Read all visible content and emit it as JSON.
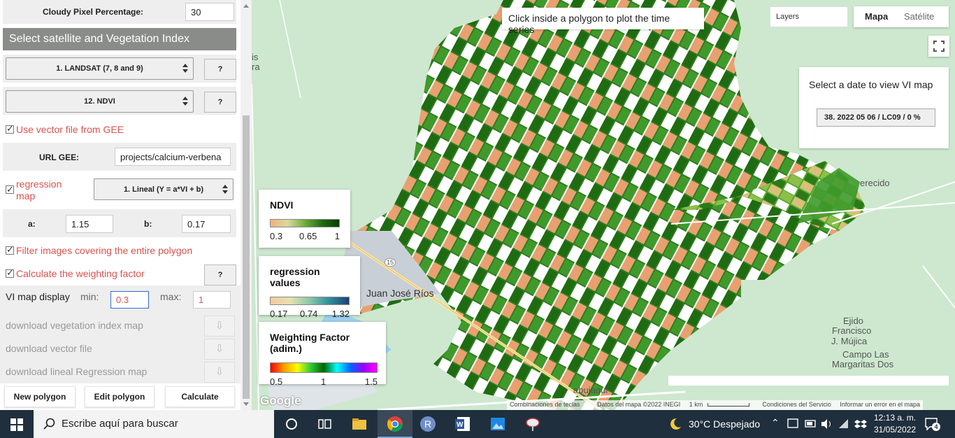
{
  "panel": {
    "cloudy_label": "Cloudy Pixel Percentage:",
    "cloudy_value": "30",
    "section_title": "Select satellite and Vegetation Index",
    "satellite_select": "1. LANDSAT (7, 8 and 9)",
    "index_select": "12. NDVI",
    "help_label": "?",
    "use_vector_label": "Use vector file from GEE",
    "url_label": "URL GEE:",
    "url_value": "projects/calcium-verbena",
    "regression_label": "regression map",
    "regression_select": "1. Lineal (Y = a*VI + b)",
    "a_label": "a:",
    "a_value": "1.15",
    "b_label": "b:",
    "b_value": "0.17",
    "filter_label": "Filter images covering the entire polygon",
    "weighting_label": "Calculate the weighting factor",
    "vi_display_label": "VI map display",
    "min_label": "min:",
    "min_value": "0.3",
    "max_label": "max:",
    "max_value": "1",
    "download_vi": "download vegetation index map",
    "download_vector": "download vector file",
    "download_regression": "download lineal Regression map",
    "download_icon": "⇩",
    "new_polygon": "New polygon",
    "edit_polygon": "Edit polygon",
    "calculate": "Calculate"
  },
  "map": {
    "notice": "Click inside a polygon to plot the time series",
    "layers": "Layers",
    "map_tab": "Mapa",
    "satellite_tab": "Satélite",
    "date_title": "Select a date to view VI map",
    "date_select": "38. 2022 05 06 / LC09 / 0 %",
    "places": {
      "juan_jose_rios": "Juan José Ríos",
      "ejido": "Ejido",
      "francisco": "Francisco",
      "mujica": "J. Mújica",
      "campo": "Campo Las",
      "margaritas": "Margaritas Dos",
      "merecido": "erecido",
      "abujaqui": "abujaqui",
      "route": "15",
      "left_is": "is",
      "left_ra": "ra"
    },
    "legends": {
      "ndvi": {
        "title": "NDVI",
        "min": "0.3",
        "mid": "0.65",
        "max": "1"
      },
      "regression": {
        "title": "regression values",
        "min": "0.17",
        "mid": "0.74",
        "max": "1.32"
      },
      "weighting": {
        "title": "Weighting Factor (adim.)",
        "min": "0.5",
        "mid": "1",
        "max": "1.5"
      }
    },
    "attribution": {
      "shortcuts": "Combinaciones de teclas",
      "data": "Datos del mapa ©2022 INEGI",
      "scale": "1 km",
      "terms": "Condiciones del Servicio",
      "report": "Informar un error en el mapa"
    },
    "google": "Google"
  },
  "taskbar": {
    "search_placeholder": "Escribe aquí para buscar",
    "weather": "30°C  Despejado",
    "time": "12:13 a. m.",
    "date": "31/05/2022",
    "notifications": "4"
  }
}
